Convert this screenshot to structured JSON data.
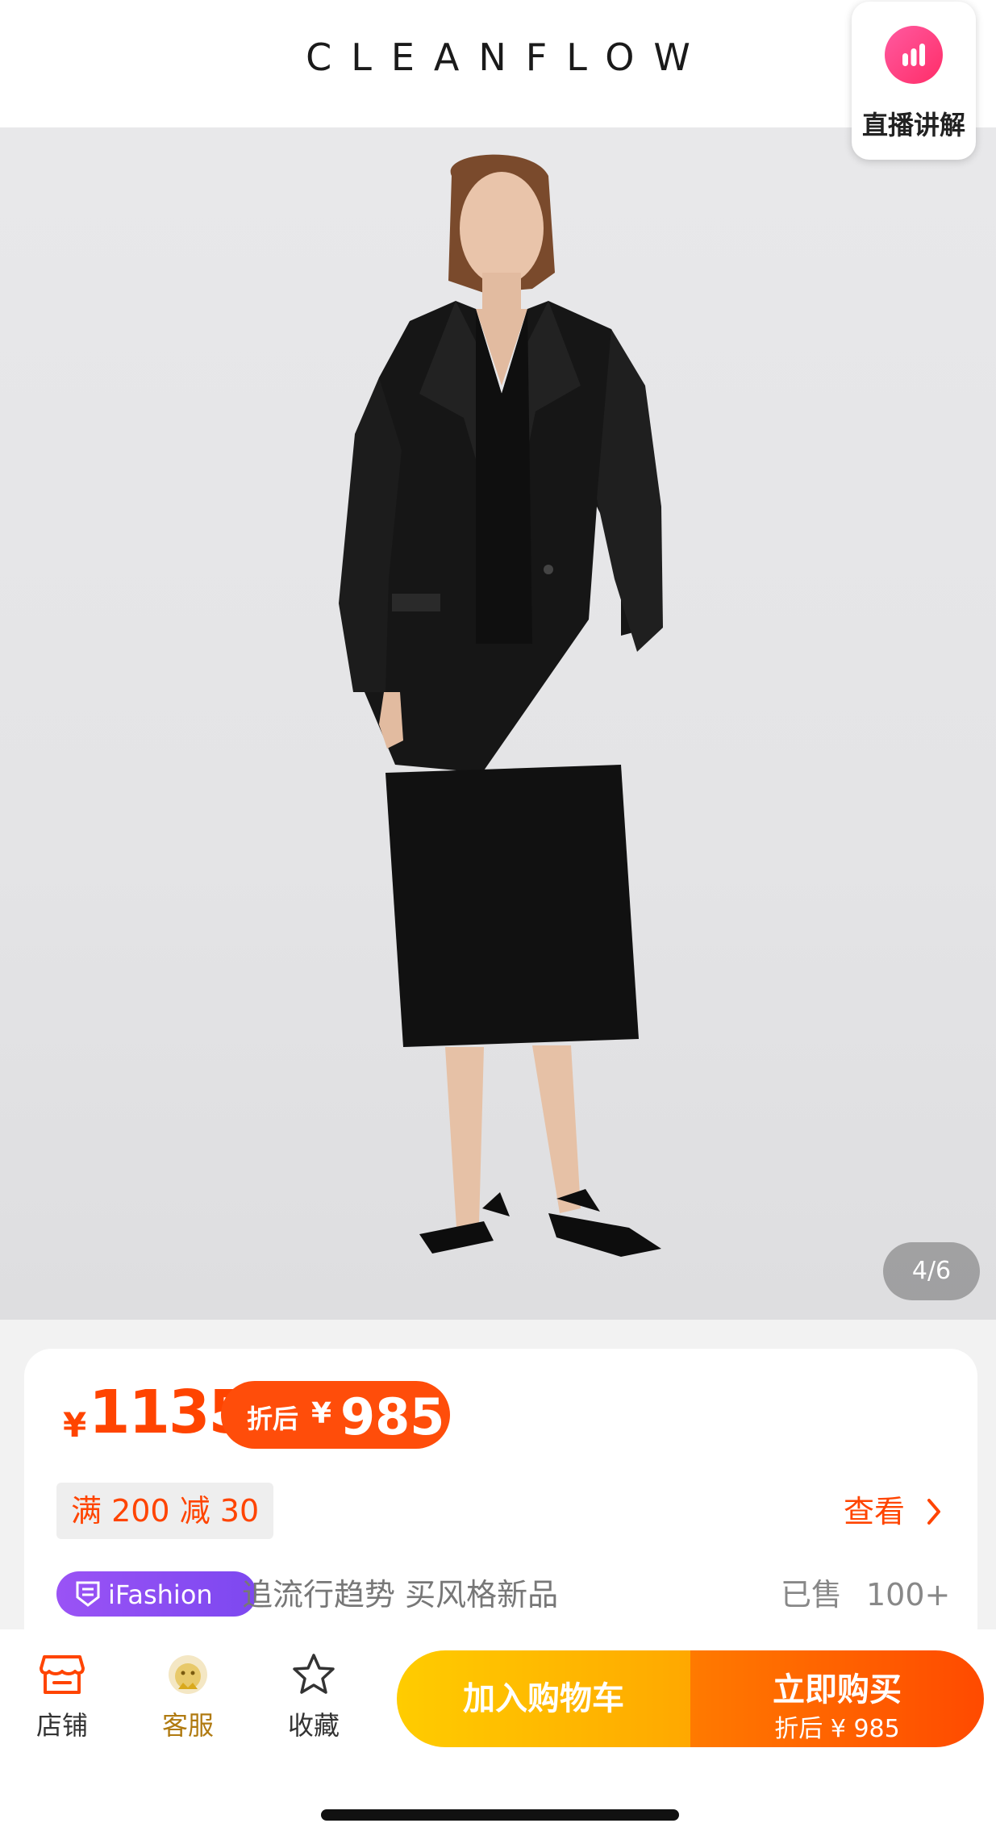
{
  "header": {
    "brand": "CLEANFLOW",
    "live_button_label": "直播讲解"
  },
  "gallery": {
    "counter": "4/6"
  },
  "product": {
    "price_symbol": "¥",
    "price": "1135",
    "discount_label": "折后",
    "discount_symbol": "¥",
    "discount_price": "985",
    "coupon": "满 200 减 30",
    "view_link": "查看",
    "ifashion_badge": "iFashion",
    "slogan": "追流行趋势 买风格新品",
    "sold_label": "已售",
    "sold_count": "100+"
  },
  "bottom_bar": {
    "tabs": [
      {
        "label": "店铺",
        "icon": "store-icon"
      },
      {
        "label": "客服",
        "icon": "customer-service-icon"
      },
      {
        "label": "收藏",
        "icon": "star-icon"
      }
    ],
    "cart_label": "加入购物车",
    "buy_label": "立即购买",
    "buy_sub": "折后 ¥ 985"
  },
  "colors": {
    "accent": "#ff4400",
    "cart_gradient_start": "#ffcc00",
    "buy_gradient_end": "#ff4a00",
    "ifashion_purple": "#8a4ef2"
  }
}
